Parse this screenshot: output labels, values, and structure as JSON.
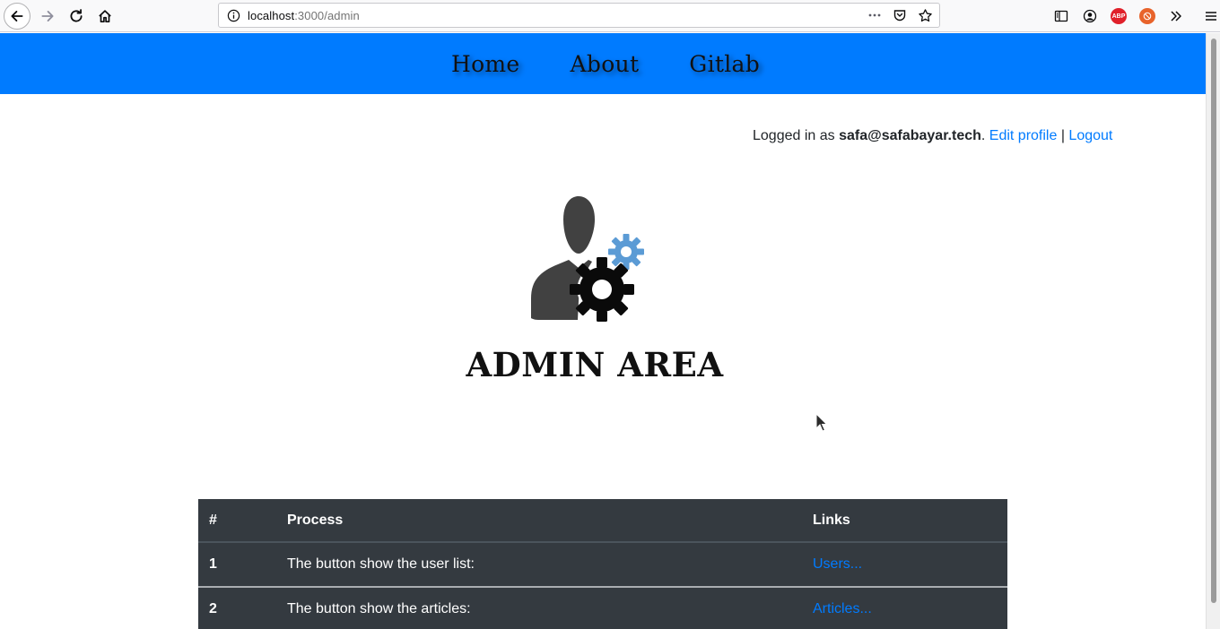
{
  "browser": {
    "url_host": "localhost",
    "url_path": ":3000/admin",
    "colors": {
      "accent": "#007bff",
      "table_bg": "#343a40"
    }
  },
  "nav": {
    "items": [
      {
        "label": "Home"
      },
      {
        "label": "About"
      },
      {
        "label": "Gitlab"
      }
    ]
  },
  "user": {
    "prefix": "Logged in as ",
    "email": "safa@safabayar.tech",
    "separator_dot": ". ",
    "edit_profile": "Edit profile",
    "pipe": " | ",
    "logout": "Logout"
  },
  "page": {
    "title": "ADMIN AREA"
  },
  "table": {
    "headers": [
      "#",
      "Process",
      "Links"
    ],
    "rows": [
      {
        "num": "1",
        "process": "The button show the user list:",
        "link": "Users..."
      },
      {
        "num": "2",
        "process": "The button show the articles:",
        "link": "Articles..."
      }
    ]
  }
}
